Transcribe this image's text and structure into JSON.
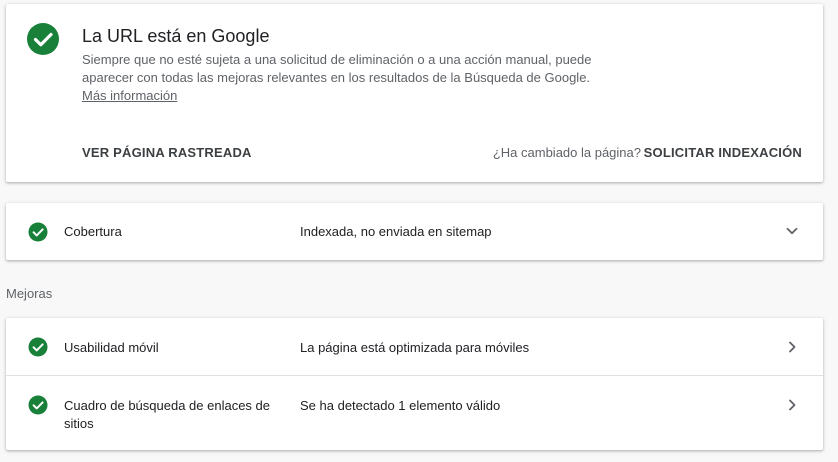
{
  "status": {
    "title": "La URL está en Google",
    "description": "Siempre que no esté sujeta a una solicitud de eliminación o a una acción manual, puede aparecer con todas las mejoras relevantes en los resultados de la Búsqueda de Google.",
    "more_info_link": "Más información",
    "view_crawled_label": "VER PÁGINA RASTREADA",
    "changed_question": "¿Ha cambiado la página?",
    "request_index_label": "SOLICITAR INDEXACIÓN"
  },
  "coverage": {
    "label": "Cobertura",
    "value": "Indexada, no enviada en sitemap"
  },
  "improvements": {
    "section_label": "Mejoras",
    "items": [
      {
        "label": "Usabilidad móvil",
        "value": "La página está optimizada para móviles"
      },
      {
        "label": "Cuadro de búsqueda de enlaces de sitios",
        "value": "Se ha detectado 1 elemento válido"
      }
    ]
  },
  "colors": {
    "success_green": "#188038",
    "text_primary": "#202124",
    "text_secondary": "#5f6368"
  },
  "icons": {
    "status": "check-circle-icon",
    "expand": "chevron-down-icon",
    "navigate": "chevron-right-icon"
  }
}
